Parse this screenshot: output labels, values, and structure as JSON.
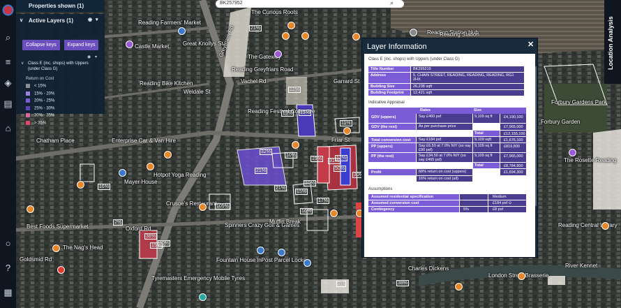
{
  "search": {
    "value": "BK257952"
  },
  "left_panel": {
    "properties_label": "Properties shown (1)",
    "active_layers_label": "Active Layers (1)",
    "collapse_label": "Collapse keys",
    "expand_label": "Expand keys",
    "layer_name": "Class E (inc. shops) with Uppers (under Class G)",
    "legend_title": "Return on Cost",
    "bins": [
      {
        "label": "< 15%",
        "color": "#8a8f95"
      },
      {
        "label": "15% - 20%",
        "color": "#9b7fe0"
      },
      {
        "label": "20% - 25%",
        "color": "#7b5bd6"
      },
      {
        "label": "25% - 30%",
        "color": "#5b45b8"
      },
      {
        "label": "30% - 35%",
        "color": "#d66a9b"
      },
      {
        "label": "> 35%",
        "color": "#e04a6a"
      }
    ]
  },
  "right_tab": {
    "label": "Location Analysis"
  },
  "layer_info": {
    "title": "Layer Information",
    "close": "✕",
    "layer_name": "Class E (inc. shops) with Uppers (under Class G)",
    "details": [
      {
        "k": "Title Number",
        "v": "BK295219"
      },
      {
        "k": "Address",
        "v": "5, CHAIN STREET, READING, READING, READING, RG1 2HX"
      },
      {
        "k": "Building Size",
        "v": "26,238 sqft"
      },
      {
        "k": "Building Footprint",
        "v": "12,421 sqft"
      }
    ],
    "appraisal_title": "Indicative Appraisal",
    "col_rates": "Rates",
    "col_size": "Size",
    "rows": [
      {
        "k": "GDV (uppers)",
        "rate": "Say £460 psf",
        "size": "9,109 sq ft",
        "val": "£4,190,100"
      },
      {
        "k": "GDV (the rest)",
        "rate": "As per purchase price",
        "size": "",
        "val": "£7,965,000"
      },
      {
        "k": "",
        "rate": "",
        "size": "Total",
        "val": "£12,155,100"
      },
      {
        "k": "Total conversion cost",
        "rate": "Say £184 psf",
        "size": "9,109 sqft",
        "val": "£1,676,100"
      },
      {
        "k": "PP (uppers)",
        "rate": "Say £6.50 at 7.0% NIY (so say £90 psf)",
        "size": "9,109 sq ft",
        "val": "£819,800"
      },
      {
        "k": "PP (the rest)",
        "rate": "Say £34.50 at 7.0% NIY (so say £465 psf)",
        "size": "9,109 sq ft",
        "val": "£7,965,000"
      },
      {
        "k": "",
        "rate": "",
        "size": "Total",
        "val": "£8,784,800"
      },
      {
        "k": "Profit",
        "rate": "68% return on cost (uppers)",
        "size": "",
        "val": "£1,694,300"
      },
      {
        "k": "",
        "rate": "16% return on cost (all)",
        "size": "",
        "val": ""
      }
    ],
    "assumptions_title": "Assumptions",
    "assumptions": [
      {
        "k": "Assumed residential specification",
        "a": "",
        "b": "Medium"
      },
      {
        "k": "Assumed conversion cost",
        "a": "",
        "b": "£184 psf ⊙"
      },
      {
        "k": "Contingency",
        "a": "5%",
        "b": "£8 psf"
      }
    ]
  },
  "map_labels": [
    "Reading Farmers' Market",
    "Castle Market",
    "Chatham Place",
    "Enterprise Car & Van Hire",
    "Reading Bike Kitchen",
    "Weldale St",
    "Great Knollys St",
    "Reading Greyfriars Road",
    "The Gateway",
    "Reading Festival Collective",
    "Garrard St",
    "Reading Station Hub",
    "Hotpot Yoga Reading",
    "Mayer House",
    "Crusoe's Restaurant",
    "Oxford Rd",
    "Best Foods Supermarket",
    "The Nag's Head",
    "Goldsmid Rd",
    "Spinners Crazy Golf & Games",
    "Muffin Break",
    "Fountain House",
    "InPost Parcel Locker",
    "Tyremasters Emergency Mobile Tyres",
    "Reading Station",
    "Forbury Gardens Park",
    "Forbury Garden",
    "The Rosette Reading",
    "Reading Central Library",
    "River Kennet",
    "Charles Dickens",
    "London Street Brasserie",
    "The Curious Roots",
    "Friar St",
    "Vachel Rd",
    "Greyfriars Rd"
  ],
  "pct_labels": [
    "21%",
    "12%",
    "13%",
    "11%",
    "21%",
    "10%",
    "10%",
    "15%",
    "16%",
    "19%",
    "31%",
    "21%",
    "17%",
    "12%",
    "32%",
    "50%",
    "30%",
    "13%",
    "16%",
    "105%",
    "38%",
    "15%",
    "2%",
    "30%",
    "38%",
    "3%"
  ]
}
